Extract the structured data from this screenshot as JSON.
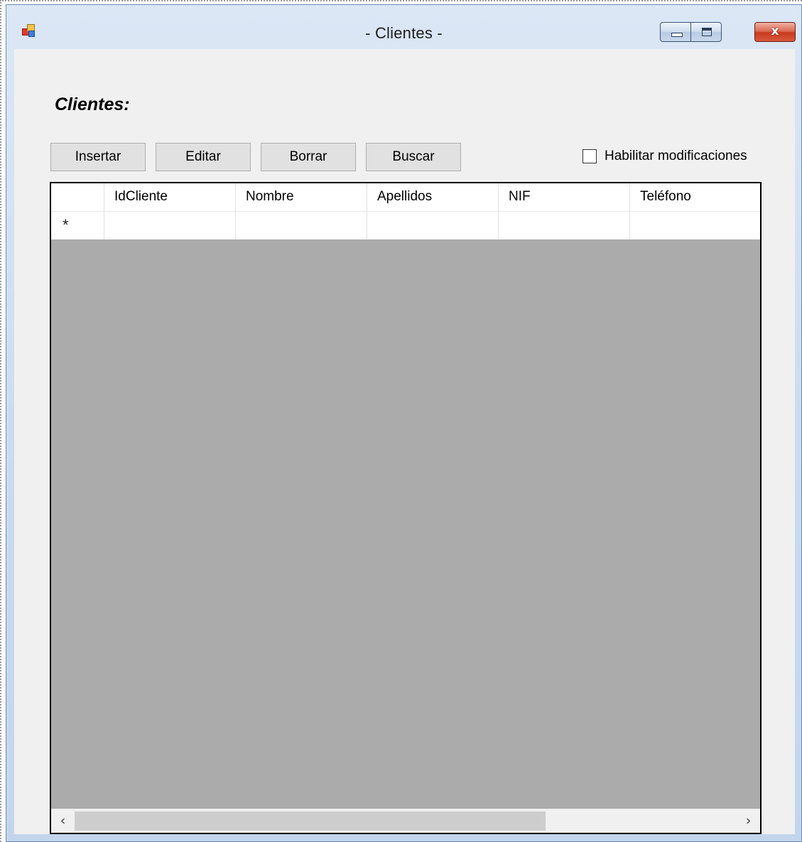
{
  "window": {
    "title": "- Clientes -",
    "close_glyph": "x"
  },
  "heading": "Clientes:",
  "toolbar": {
    "buttons": [
      {
        "label": "Insertar"
      },
      {
        "label": "Editar"
      },
      {
        "label": "Borrar"
      },
      {
        "label": "Buscar"
      }
    ],
    "checkbox": {
      "label": "Habilitar modificaciones",
      "checked": false
    }
  },
  "grid": {
    "columns": [
      "IdCliente",
      "Nombre",
      "Apellidos",
      "NIF",
      "Teléfono"
    ],
    "new_row_marker": "*",
    "rows": [],
    "hscroll": {
      "left_arrow": "‹",
      "right_arrow": "›"
    }
  },
  "colors": {
    "grid_background": "#ababab",
    "form_background": "#f0f0f0",
    "button_background": "#e1e1e1",
    "close_button": "#c8391f"
  }
}
